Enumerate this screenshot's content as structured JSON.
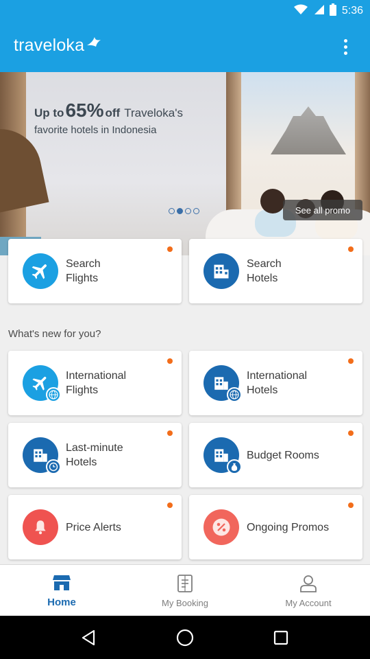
{
  "status_bar": {
    "time": "5:36",
    "icons": [
      "wifi-icon",
      "cellular-signal-icon",
      "battery-icon"
    ]
  },
  "app_bar": {
    "brand": "traveloka",
    "menu_icon": "more-vertical-icon"
  },
  "banner": {
    "prefix": "Up to",
    "discount": "65%",
    "off": "off",
    "brand": "Traveloka's",
    "subtitle": "favorite hotels in Indonesia",
    "carousel": {
      "count": 4,
      "active_index": 1
    },
    "see_all_label": "See all promo"
  },
  "quick_actions": [
    {
      "label": "Search\nFlights",
      "icon": "airplane-icon",
      "color": "#1ba0e2"
    },
    {
      "label": "Search\nHotels",
      "icon": "hotel-icon",
      "color": "#1b6ab0"
    }
  ],
  "whats_new": {
    "title": "What's new for you?",
    "items": [
      {
        "label": "International\nFlights",
        "icon": "airplane-globe-icon",
        "color": "#1ba0e2"
      },
      {
        "label": "International\nHotels",
        "icon": "hotel-globe-icon",
        "color": "#1b6ab0"
      },
      {
        "label": "Last-minute\nHotels",
        "icon": "hotel-clock-icon",
        "color": "#1b6ab0"
      },
      {
        "label": "Budget Rooms",
        "icon": "hotel-money-icon",
        "color": "#1b6ab0"
      },
      {
        "label": "Price Alerts",
        "icon": "bell-icon",
        "color": "#ef5350"
      },
      {
        "label": "Ongoing Promos",
        "icon": "percent-icon",
        "color": "#f1665c"
      }
    ]
  },
  "bottom_nav": {
    "items": [
      {
        "label": "Home",
        "icon": "home-icon",
        "active": true
      },
      {
        "label": "My Booking",
        "icon": "booking-icon",
        "active": false
      },
      {
        "label": "My Account",
        "icon": "account-icon",
        "active": false
      }
    ]
  },
  "system_nav": [
    "back-icon",
    "home-circle-icon",
    "recents-icon"
  ],
  "colors": {
    "primary": "#1ba0e2",
    "secondary": "#1b6ab0",
    "notification_dot": "#f26d1a"
  }
}
